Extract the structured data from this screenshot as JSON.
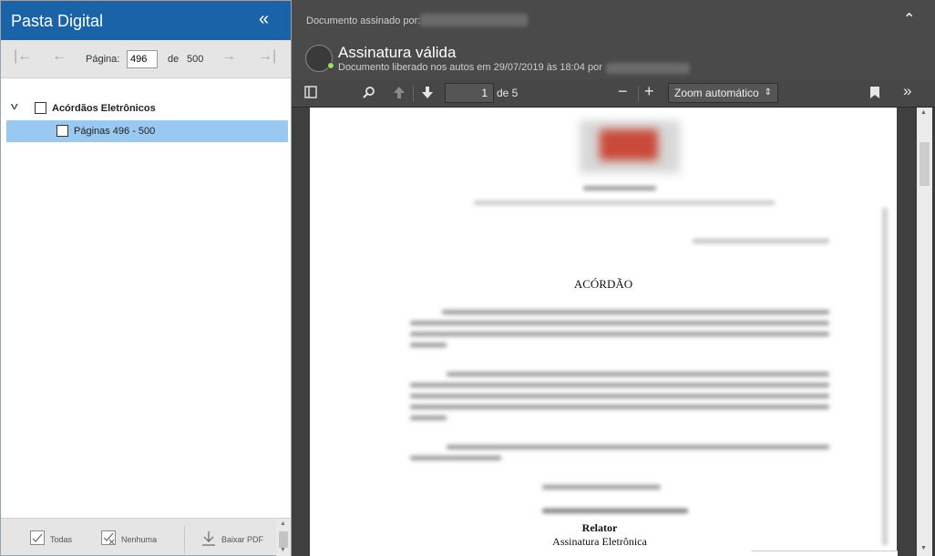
{
  "left_panel": {
    "title": "Pasta Digital",
    "collapse_icon": "«",
    "pager": {
      "page_label": "Página:",
      "current_page": "496",
      "of_label": "de",
      "total_pages": "500"
    },
    "tree": {
      "root_label": "Acórdãos Eletrônicos",
      "child_label": "Páginas 496 - 500"
    },
    "footer": {
      "all_label": "Todas",
      "none_label": "Nenhuma",
      "download_label": "Baixar PDF"
    }
  },
  "signature": {
    "signed_by_label": "Documento assinado por:",
    "status_title": "Assinatura válida",
    "released_text": "Documento liberado nos autos em 29/07/2019 às 18:04 por"
  },
  "pdf_toolbar": {
    "page_value": "1",
    "of_pages": "de 5",
    "zoom": "Zoom automático"
  },
  "document": {
    "heading": "ACÓRDÃO",
    "relator": "Relator",
    "signature_line": "Assinatura Eletrônica"
  },
  "colors": {
    "header_blue": "#1a63a8",
    "selected_row": "#99c9f1",
    "valid_dot": "#9fe06a"
  }
}
